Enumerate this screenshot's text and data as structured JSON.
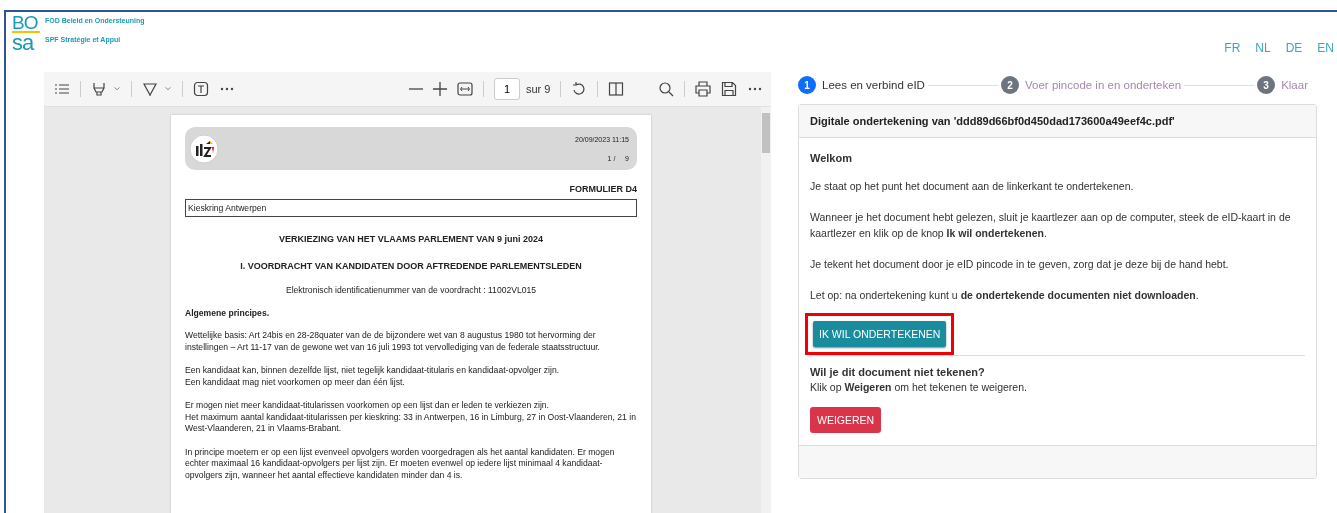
{
  "header": {
    "logo": {
      "top": "BO",
      "bottom": "sa"
    },
    "org_names": [
      "FOD Beleid en Ondersteuning",
      "SPF Stratégie et Appui"
    ],
    "languages": [
      "FR",
      "NL",
      "DE",
      "EN"
    ]
  },
  "viewer": {
    "toolbar": {
      "page_number": "1",
      "page_total": "sur 9"
    },
    "document": {
      "date": "20/09/2023 11:15",
      "page_counter": "1 /     9",
      "form_label": "FORMULIER D4",
      "district": "Kieskring Antwerpen",
      "title": "VERKIEZING VAN HET VLAAMS PARLEMENT VAN 9 juni 2024",
      "subtitle": "I. VOORDRACHT VAN KANDIDATEN DOOR AFTREDENDE PARLEMENTSLEDEN",
      "id_line": "Elektronisch identificatienummer van de voordracht : 11002VL015",
      "section_heading": "Algemene principes.",
      "paragraphs": [
        [
          "Wettelijke basis: Art 24bis en 28-28quater van de de bijzondere wet van 8 augustus 1980 tot hervorming der instellingen – Art 11-17 van de gewone wet van 16 juli 1993 tot vervollediging van de federale staatsstructuur."
        ],
        [
          "Een kandidaat kan, binnen dezelfde lijst, niet tegelijk kandidaat-titularis en kandidaat-opvolger zijn.",
          "Een kandidaat mag niet voorkomen op meer dan één lijst."
        ],
        [
          "Er mogen niet meer kandidaat-titularissen voorkomen op een lijst dan er leden te verkiezen zijn.",
          "Het maximum aantal kandidaat-titularissen per kieskring: 33 in Antwerpen, 16 in Limburg, 27 in Oost-Vlaanderen, 21 in West-Vlaanderen, 21 in Vlaams-Brabant."
        ],
        [
          "In principe moetern er op een lijst evenveel opvolgers worden voorgedragen als het aantal kandidaten. Er mogen echter maximaal 16 kandidaat-opvolgers per lijst zijn. Er moeten evenwel op iedere lijst minimaal 4 kandidaat-opvolgers zijn, wanneer het aantal effectieve kandidaten minder dan 4 is."
        ]
      ]
    }
  },
  "steps": [
    {
      "number": "1",
      "label": "Lees en verbind eID",
      "selected": true
    },
    {
      "number": "2",
      "label": "Voer pincode in en onderteken",
      "selected": false
    },
    {
      "number": "3",
      "label": "Klaar",
      "selected": false
    }
  ],
  "card": {
    "title": "Digitale ondertekening van 'ddd89d66bf0d450dad173600a49eef4c.pdf'",
    "welcome": "Welkom",
    "paragraphs": [
      "Je staat op het punt het document aan de linkerkant te ondertekenen.",
      "Wanneer je het document hebt gelezen, sluit je kaartlezer aan op de computer, steek de eID-kaart in de kaartlezer en klik op de knop **Ik wil ondertekenen**.",
      "Je tekent het document door je eID pincode in te geven, zorg dat je deze bij de hand hebt.",
      "Let op: na ondertekening kunt u **de ondertekende documenten niet downloaden**."
    ],
    "sign_button": {
      "label": "IK WIL ONDERTEKENEN",
      "highlighted": true
    },
    "decline_heading": "Wil je dit document niet tekenen?",
    "decline_text": "Klik op **Weigeren** om het tekenen te weigeren.",
    "decline_button": {
      "label": "WEIGEREN"
    }
  }
}
